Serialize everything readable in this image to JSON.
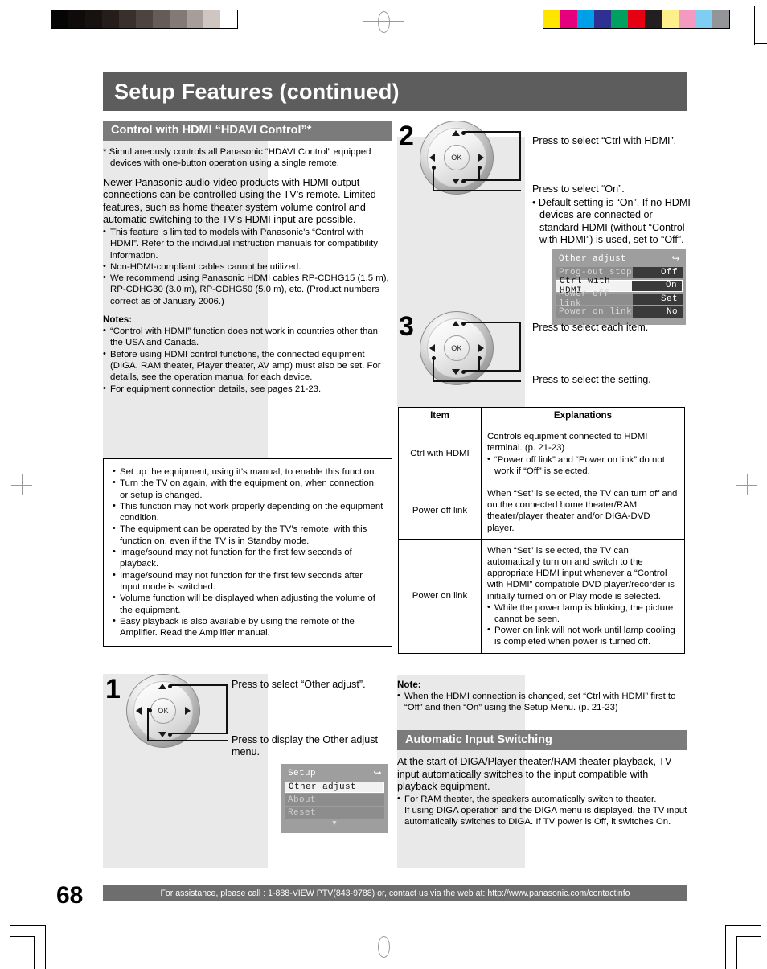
{
  "marks": {
    "grayscale_swatches": [
      "#050505",
      "#0e0b0a",
      "#17120f",
      "#241d19",
      "#3a302b",
      "#4e443f",
      "#665c57",
      "#837a75",
      "#a79e9a",
      "#cfc6c2",
      "#ffffff"
    ],
    "color_swatches": [
      "#ffe500",
      "#e6007e",
      "#00a0e9",
      "#2e3192",
      "#00a160",
      "#e60012",
      "#231f20",
      "#fdf08a",
      "#f49ac1",
      "#7ecef4",
      "#939598"
    ]
  },
  "header": {
    "title": "Setup Features (continued)"
  },
  "left": {
    "section_heading": "Control with HDMI “HDAVI Control”*",
    "footnote": "* Simultaneously controls all Panasonic “HDAVI Control” equipped devices with one-button operation using a single remote.",
    "intro": "Newer Panasonic audio-video products with HDMI output connections can be controlled using the TV’s remote. Limited features, such as home theater system volume control and automatic switching to the TV’s HDMI input are possible.",
    "intro_bullets": [
      "This feature is limited to models with Panasonic’s “Control with HDMI”. Refer to the individual instruction manuals for compatibility information.",
      "Non-HDMI-compliant cables cannot be utilized.",
      "We recommend using Panasonic HDMI cables RP-CDHG15 (1.5 m), RP-CDHG30 (3.0 m), RP-CDHG50 (5.0 m), etc. (Product numbers correct as of January 2006.)"
    ],
    "notes_heading": "Notes:",
    "notes_bullets": [
      "“Control with HDMI” function does not work in countries other than the USA and Canada.",
      "Before using HDMI control functions, the connected equipment (DIGA, RAM theater, Player theater, AV amp) must also be set. For details, see the operation manual for each device.",
      "For equipment connection details, see pages 21-23."
    ],
    "tips_bullets": [
      "Set up the equipment, using it’s manual, to enable this function.",
      "Turn the TV on again, with the equipment on, when connection or setup is changed.",
      "This function may not work properly depending on the equipment condition.",
      "The equipment can be operated by the TV’s remote, with this function on, even if the TV is in Standby mode.",
      "Image/sound may not function for the first few seconds of playback.",
      "Image/sound may not function for the first few seconds after Input mode is switched.",
      "Volume function will be displayed when adjusting the volume of the equipment.",
      "Easy playback is also available by using the remote of the Amplifier. Read the Amplifier manual."
    ],
    "step1": {
      "number": "1",
      "ok_label": "OK",
      "callout_updown": "Press to select “Other adjust”.",
      "callout_ok": "Press to display the Other adjust menu."
    },
    "setup_osd": {
      "title": "Setup",
      "return_icon": "return-arrow-icon",
      "rows": [
        {
          "label": "Other adjust",
          "state": "selected"
        },
        {
          "label": "About",
          "state": "dim"
        },
        {
          "label": "Reset",
          "state": "dim"
        }
      ],
      "more_icon": "chevron-down-icon"
    }
  },
  "right": {
    "step2": {
      "number": "2",
      "ok_label": "OK",
      "callout_updown": "Press to select “Ctrl with HDMI”.",
      "callout_leftright": "Press to select “On”.",
      "callout_leftright_bullet": "Default setting is “On”. If no HDMI devices are connected or standard HDMI (without “Control with HDMI”) is used, set to “Off”."
    },
    "other_adjust_osd": {
      "title": "Other adjust",
      "return_icon": "return-arrow-icon",
      "rows": [
        {
          "label": "Prog-out stop",
          "value": "Off",
          "state": "normal"
        },
        {
          "label": "Ctrl with HDMI",
          "value": "On",
          "state": "highlighted"
        },
        {
          "label": "Power off link",
          "value": "Set",
          "state": "normal"
        },
        {
          "label": "Power on link",
          "value": "No",
          "state": "normal"
        }
      ]
    },
    "step3": {
      "number": "3",
      "ok_label": "OK",
      "callout_updown": "Press to select each item.",
      "callout_leftright": "Press to select the setting."
    },
    "table": {
      "headers": [
        "Item",
        "Explanations"
      ],
      "rows": [
        {
          "item": "Ctrl with HDMI",
          "text": "Controls equipment connected to HDMI terminal. (p. 21-23)",
          "bullets": [
            "“Power off link” and “Power on link” do not work if “Off” is selected."
          ]
        },
        {
          "item": "Power off link",
          "text": "When “Set” is selected, the TV can turn off and on the connected home theater/RAM theater/player theater and/or DIGA-DVD player.",
          "bullets": []
        },
        {
          "item": "Power on link",
          "text": "When “Set” is selected, the TV can automatically turn on and switch to the appropriate HDMI input whenever a “Control with HDMI” compatible DVD player/recorder is initially turned on or Play mode is selected.",
          "bullets": [
            "While the power lamp is blinking, the picture cannot be seen.",
            "Power on link will not work until lamp cooling is completed when power is turned off."
          ]
        }
      ]
    },
    "note_heading": "Note:",
    "note_bullets": [
      "When the HDMI connection is changed, set “Ctrl with HDMI” first to “Off” and then “On” using the Setup Menu. (p. 21-23)"
    ],
    "auto_input": {
      "heading": "Automatic Input Switching",
      "body": "At the start of DIGA/Player theater/RAM theater playback, TV input automatically switches to the input compatible with playback equipment.",
      "bullets": [
        "For RAM theater, the speakers automatically switch to theater."
      ],
      "continuation": "If using DIGA operation and the DIGA menu is displayed, the TV input automatically switches to DIGA. If TV power is Off, it switches On."
    }
  },
  "footer": {
    "page_number": "68",
    "assistance": "For assistance, please call : 1-888-VIEW PTV(843-9788) or, contact us via the web at: http://www.panasonic.com/contactinfo"
  }
}
